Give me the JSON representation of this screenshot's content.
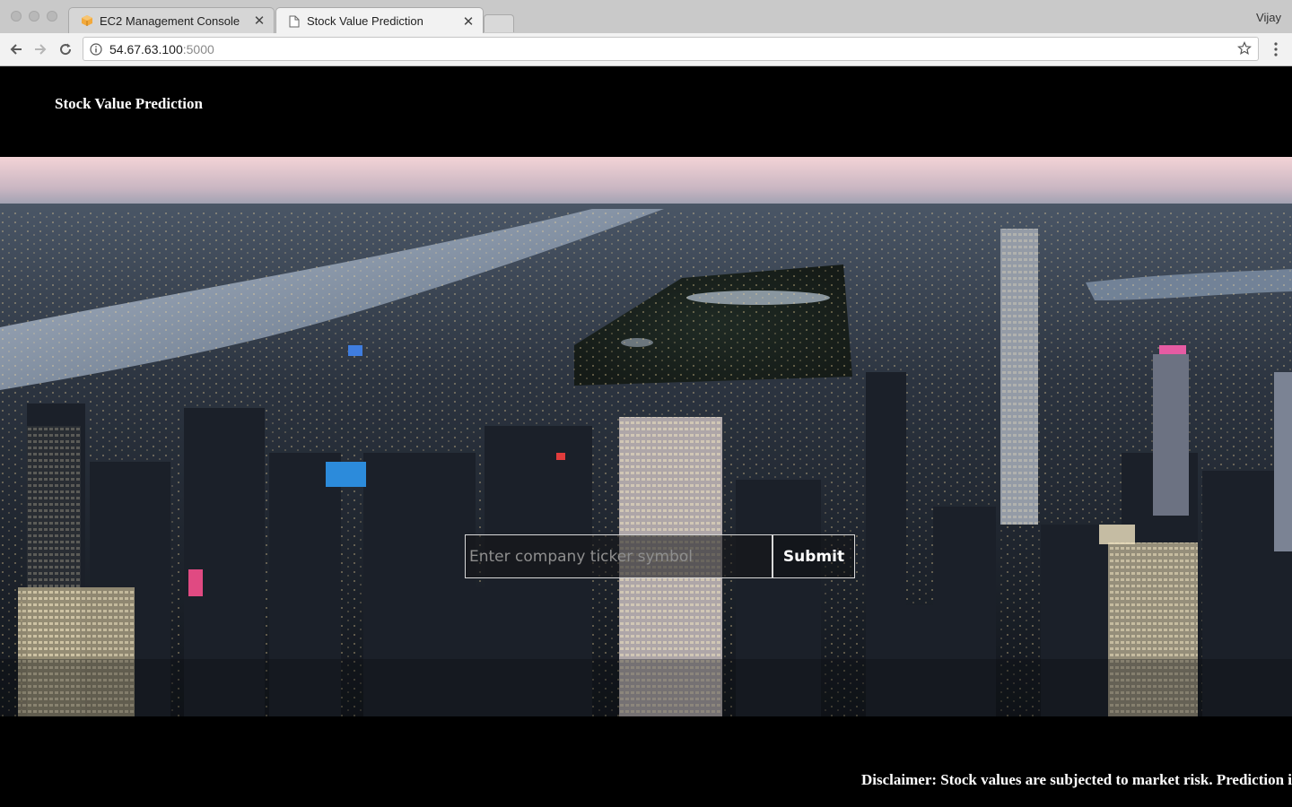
{
  "browser": {
    "tabs": [
      {
        "title": "EC2 Management Console",
        "icon": "aws-cube-icon",
        "active": false
      },
      {
        "title": "Stock Value Prediction",
        "icon": "document-icon",
        "active": true
      }
    ],
    "profile_name": "Vijay",
    "url": {
      "host": "54.67.63.100",
      "port": ":5000"
    }
  },
  "header": {
    "title": "Stock Value Prediction"
  },
  "search": {
    "placeholder": "Enter company ticker symbol",
    "value": "",
    "submit_label": "Submit"
  },
  "hero": {
    "description_icon": "city-skyline-background"
  },
  "footer": {
    "disclaimer": "Disclaimer: Stock values are subjected to market risk. Prediction is"
  },
  "colors": {
    "page_background": "#000000",
    "text": "#ffffff",
    "placeholder": "#8e8e8e",
    "input_border": "#d9d9d9"
  }
}
